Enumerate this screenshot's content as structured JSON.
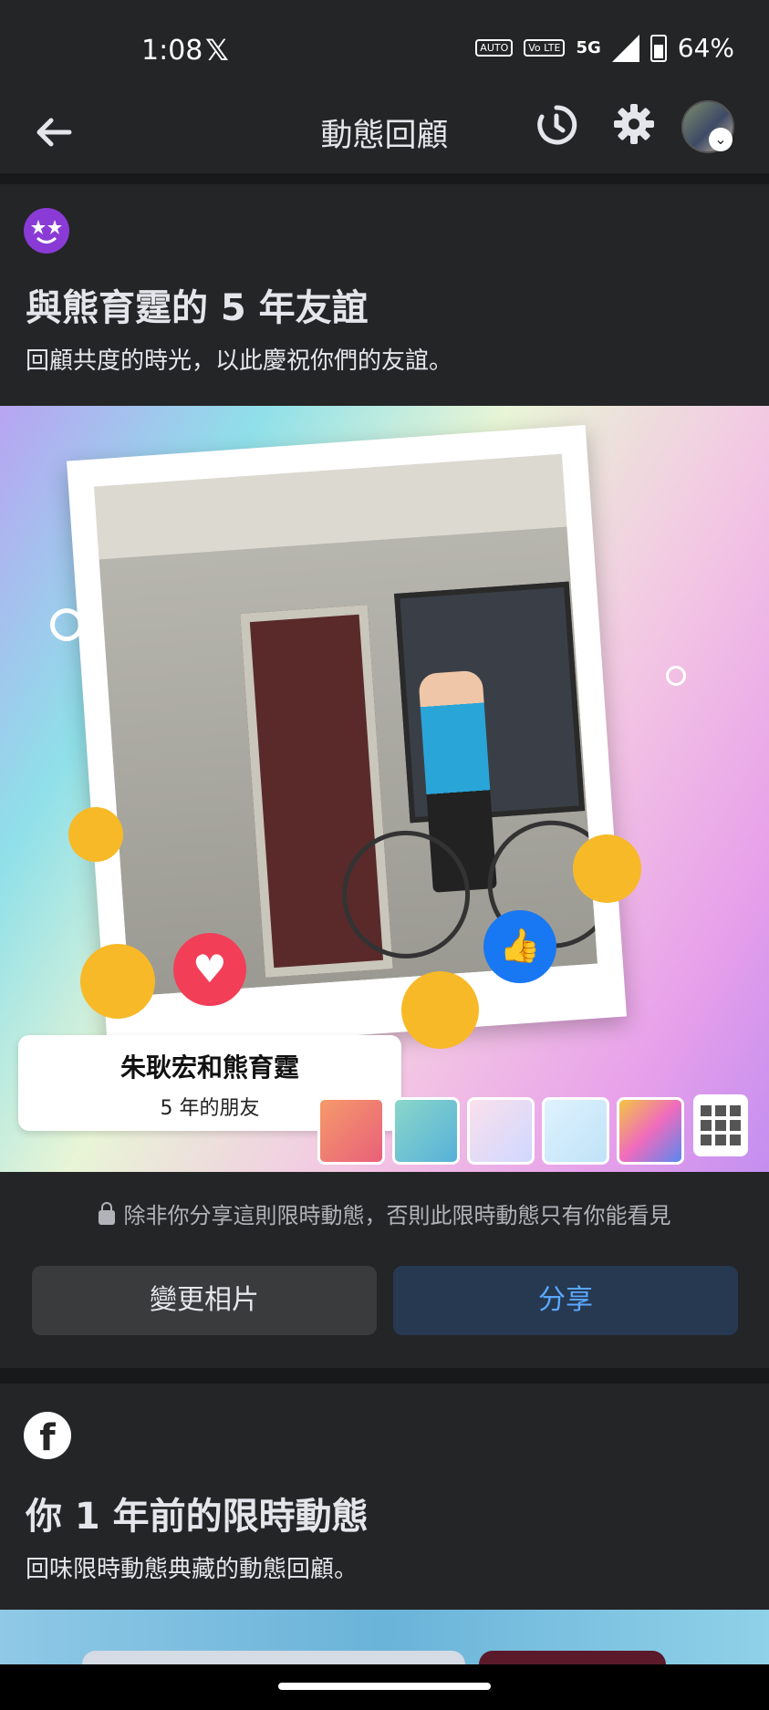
{
  "status_bar": {
    "time": "1:08",
    "x_logo": "𝕏",
    "badge_auto": "AUTO",
    "badge_vo": "Vo LTE",
    "network": "5G",
    "battery": "64%"
  },
  "app_bar": {
    "title": "動態回顧",
    "icons": [
      "back-arrow-icon",
      "history-icon",
      "gear-icon",
      "profile-avatar"
    ]
  },
  "friendship_card": {
    "heading": "與熊育霆的 5 年友誼",
    "subheading": "回顧共度的時光，以此慶祝你們的友誼。",
    "caption_title": "朱耿宏和熊育霆",
    "caption_sub": "5 年的朋友",
    "privacy_note": "除非你分享這則限時動態，否則此限時動態只有你能看見",
    "change_photo_label": "變更相片",
    "share_label": "分享",
    "colors": {
      "share_bg": "#263951",
      "share_text": "#5aa7ff",
      "change_bg": "#3a3b3c"
    }
  },
  "memories_card": {
    "heading": "你 1 年前的限時動態",
    "subheading": "回味限時動態典藏的動態回顧。"
  }
}
